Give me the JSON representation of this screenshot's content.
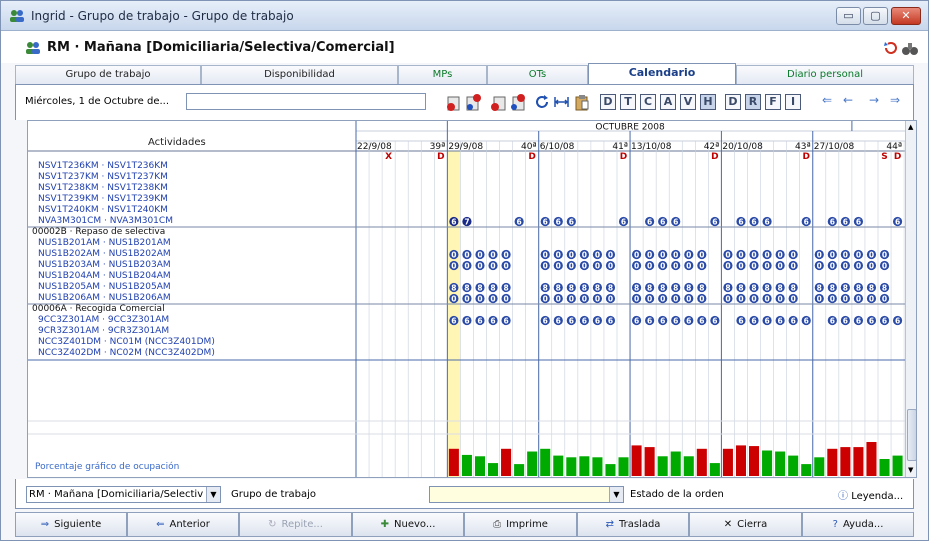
{
  "window": {
    "title": "Ingrid - Grupo de trabajo - Grupo de trabajo",
    "min": "▭",
    "max": "▢",
    "close": "✕"
  },
  "header": {
    "title": "RM · Mañana [Domiciliaria/Selectiva/Comercial]"
  },
  "tabs": [
    "Grupo de trabajo",
    "Disponibilidad",
    "MPs",
    "OTs",
    "Calendario",
    "Diario personal"
  ],
  "toolbar": {
    "date_label": "Miércoles, 1 de Octubre de...",
    "date_value": "",
    "day_letters": [
      "D",
      "T",
      "C",
      "A",
      "V",
      "H",
      "D",
      "R",
      "F",
      "I"
    ],
    "active_letters": [
      5,
      7
    ]
  },
  "calendar": {
    "month": "OCTUBRE 2008",
    "activities_header": "Actividades",
    "weeks": [
      {
        "date": "22/9/08",
        "num": "39ª"
      },
      {
        "date": "29/9/08",
        "num": "40ª"
      },
      {
        "date": "6/10/08",
        "num": "41ª"
      },
      {
        "date": "13/10/08",
        "num": "42ª"
      },
      {
        "date": "20/10/08",
        "num": "43ª"
      },
      {
        "date": "27/10/08",
        "num": "44ª"
      }
    ],
    "day_markers": [
      {
        "day": 2,
        "text": "X",
        "color": "#c00000"
      },
      {
        "day": 6,
        "text": "D",
        "color": "#c00000"
      },
      {
        "day": 13,
        "text": "D",
        "color": "#c00000"
      },
      {
        "day": 20,
        "text": "D",
        "color": "#c00000"
      },
      {
        "day": 27,
        "text": "D",
        "color": "#c00000"
      },
      {
        "day": 34,
        "text": "D",
        "color": "#c00000"
      },
      {
        "day": 40,
        "text": "S",
        "color": "#c00000"
      },
      {
        "day": 41,
        "text": "D",
        "color": "#c00000"
      }
    ],
    "rows": [
      {
        "label": "NSV1T236KM · NSV1T236KM",
        "type": "item",
        "mark": "",
        "days": []
      },
      {
        "label": "NSV1T237KM · NSV1T237KM",
        "type": "item",
        "mark": "",
        "days": []
      },
      {
        "label": "NSV1T238KM · NSV1T238KM",
        "type": "item",
        "mark": "",
        "days": []
      },
      {
        "label": "NSV1T239KM · NSV1T239KM",
        "type": "item",
        "mark": "",
        "days": []
      },
      {
        "label": "NSV1T240KM · NSV1T240KM",
        "type": "item",
        "mark": "",
        "days": []
      },
      {
        "label": "NVA3M301CM · NVA3M301CM",
        "type": "item",
        "mark": "6",
        "days": [
          7,
          8,
          12,
          14,
          15,
          16,
          20,
          22,
          23,
          24,
          27,
          29,
          30,
          31,
          34,
          36,
          37,
          38,
          41
        ],
        "dark": [
          7,
          8
        ],
        "dark_marks": [
          "6",
          "7"
        ]
      },
      {
        "label": "00002B · Repaso de selectiva",
        "type": "group",
        "mark": "",
        "days": []
      },
      {
        "label": "NUS1B201AM · NUS1B201AM",
        "type": "item",
        "mark": "",
        "days": []
      },
      {
        "label": "NUS1B202AM · NUS1B202AM",
        "type": "item",
        "mark": "0",
        "days": [
          7,
          8,
          9,
          10,
          11,
          14,
          15,
          16,
          17,
          18,
          19,
          21,
          22,
          23,
          24,
          25,
          26,
          28,
          29,
          30,
          31,
          32,
          33,
          35,
          36,
          37,
          38,
          39,
          40
        ]
      },
      {
        "label": "NUS1B203AM · NUS1B203AM",
        "type": "item",
        "mark": "0",
        "days": [
          7,
          8,
          9,
          10,
          11,
          14,
          15,
          16,
          17,
          18,
          19,
          21,
          22,
          23,
          24,
          25,
          26,
          28,
          29,
          30,
          31,
          32,
          33,
          35,
          36,
          37,
          38,
          39,
          40
        ]
      },
      {
        "label": "NUS1B204AM · NUS1B204AM",
        "type": "item",
        "mark": "",
        "days": []
      },
      {
        "label": "NUS1B205AM · NUS1B205AM",
        "type": "item",
        "mark": "8",
        "days": [
          7,
          8,
          9,
          10,
          11,
          14,
          15,
          16,
          17,
          18,
          19,
          21,
          22,
          23,
          24,
          25,
          26,
          28,
          29,
          30,
          31,
          32,
          33,
          35,
          36,
          37,
          38,
          39,
          40
        ]
      },
      {
        "label": "NUS1B206AM · NUS1B206AM",
        "type": "item",
        "mark": "0",
        "days": [
          7,
          8,
          9,
          10,
          11,
          14,
          15,
          16,
          17,
          18,
          19,
          21,
          22,
          23,
          24,
          25,
          26,
          28,
          29,
          30,
          31,
          32,
          33,
          35,
          36,
          37,
          38,
          39,
          40
        ]
      },
      {
        "label": "00006A · Recogida Comercial",
        "type": "group",
        "mark": "",
        "days": []
      },
      {
        "label": "9CC3Z301AM · 9CC3Z301AM",
        "type": "item",
        "mark": "6",
        "days": [
          7,
          8,
          9,
          10,
          11,
          14,
          15,
          16,
          17,
          18,
          19,
          21,
          22,
          23,
          24,
          25,
          26,
          27,
          29,
          30,
          31,
          32,
          33,
          34,
          36,
          37,
          38,
          39,
          40,
          41
        ]
      },
      {
        "label": "9CR3Z301AM · 9CR3Z301AM",
        "type": "item",
        "mark": "",
        "days": []
      },
      {
        "label": "NCC3Z401DM · NC01M (NCC3Z401DM)",
        "type": "item",
        "mark": "",
        "days": []
      },
      {
        "label": "NCC3Z402DM · NC02M (NCC3Z402DM)",
        "type": "item",
        "mark": "",
        "days": []
      }
    ],
    "occupancy_label": "Porcentaje gráfico de ocupación",
    "occupancy": [
      {
        "day": 7,
        "v": 0.8,
        "c": "#cc0000"
      },
      {
        "day": 8,
        "v": 0.62,
        "c": "#00aa00"
      },
      {
        "day": 9,
        "v": 0.58,
        "c": "#00aa00"
      },
      {
        "day": 10,
        "v": 0.38,
        "c": "#00aa00"
      },
      {
        "day": 11,
        "v": 0.8,
        "c": "#cc0000"
      },
      {
        "day": 12,
        "v": 0.35,
        "c": "#00aa00"
      },
      {
        "day": 13,
        "v": 0.72,
        "c": "#00aa00"
      },
      {
        "day": 14,
        "v": 0.8,
        "c": "#00aa00"
      },
      {
        "day": 15,
        "v": 0.6,
        "c": "#00aa00"
      },
      {
        "day": 16,
        "v": 0.55,
        "c": "#00aa00"
      },
      {
        "day": 17,
        "v": 0.58,
        "c": "#00aa00"
      },
      {
        "day": 18,
        "v": 0.55,
        "c": "#00aa00"
      },
      {
        "day": 19,
        "v": 0.35,
        "c": "#00aa00"
      },
      {
        "day": 20,
        "v": 0.55,
        "c": "#00aa00"
      },
      {
        "day": 21,
        "v": 0.9,
        "c": "#cc0000"
      },
      {
        "day": 22,
        "v": 0.85,
        "c": "#cc0000"
      },
      {
        "day": 23,
        "v": 0.58,
        "c": "#00aa00"
      },
      {
        "day": 24,
        "v": 0.72,
        "c": "#00aa00"
      },
      {
        "day": 25,
        "v": 0.58,
        "c": "#00aa00"
      },
      {
        "day": 26,
        "v": 0.8,
        "c": "#cc0000"
      },
      {
        "day": 27,
        "v": 0.38,
        "c": "#00aa00"
      },
      {
        "day": 28,
        "v": 0.8,
        "c": "#cc0000"
      },
      {
        "day": 29,
        "v": 0.9,
        "c": "#cc0000"
      },
      {
        "day": 30,
        "v": 0.88,
        "c": "#cc0000"
      },
      {
        "day": 31,
        "v": 0.75,
        "c": "#00aa00"
      },
      {
        "day": 32,
        "v": 0.72,
        "c": "#00aa00"
      },
      {
        "day": 33,
        "v": 0.6,
        "c": "#00aa00"
      },
      {
        "day": 34,
        "v": 0.35,
        "c": "#00aa00"
      },
      {
        "day": 35,
        "v": 0.55,
        "c": "#00aa00"
      },
      {
        "day": 36,
        "v": 0.8,
        "c": "#cc0000"
      },
      {
        "day": 37,
        "v": 0.85,
        "c": "#cc0000"
      },
      {
        "day": 38,
        "v": 0.85,
        "c": "#cc0000"
      },
      {
        "day": 39,
        "v": 1.0,
        "c": "#cc0000"
      },
      {
        "day": 40,
        "v": 0.5,
        "c": "#00aa00"
      },
      {
        "day": 41,
        "v": 0.6,
        "c": "#00aa00"
      }
    ],
    "highlight_day": 7,
    "colors": {
      "highlight": "#fff5b5",
      "grid_line": "#c8d0dc",
      "week_line": "#4a6aa8",
      "badge": "#2a4aa8",
      "badge_dark": "#1a2a88"
    }
  },
  "bottom": {
    "group_select": "RM · Mañana [Domiciliaria/Selectiv",
    "group_label": "Grupo de trabajo",
    "state_label": "Estado de la orden",
    "legend": "Leyenda..."
  },
  "buttons": [
    {
      "label": "Siguiente",
      "icon": "⇒",
      "disabled": false
    },
    {
      "label": "Anterior",
      "icon": "⇐",
      "disabled": false
    },
    {
      "label": "Repite...",
      "icon": "↻",
      "disabled": true
    },
    {
      "label": "Nuevo...",
      "icon": "✚",
      "disabled": false
    },
    {
      "label": "Imprime",
      "icon": "⎙",
      "disabled": false
    },
    {
      "label": "Traslada",
      "icon": "⇄",
      "disabled": false
    },
    {
      "label": "Cierra",
      "icon": "✕",
      "disabled": false
    },
    {
      "label": "Ayuda...",
      "icon": "?",
      "disabled": false
    }
  ]
}
